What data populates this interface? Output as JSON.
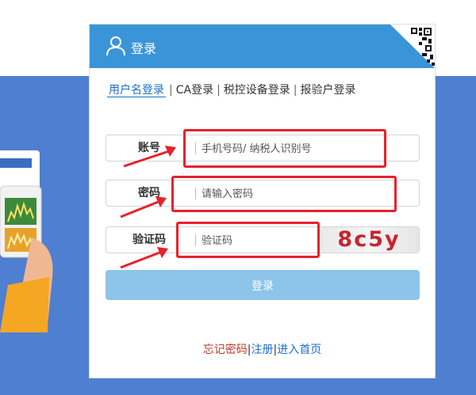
{
  "header": {
    "title": "登录"
  },
  "tabs": [
    {
      "label": "用户名登录",
      "active": true
    },
    {
      "label": "CA登录",
      "active": false
    },
    {
      "label": "税控设备登录",
      "active": false
    },
    {
      "label": "报验户登录",
      "active": false
    }
  ],
  "fields": {
    "account": {
      "label": "账号",
      "placeholder": "手机号码/ 纳税人识别号",
      "value": ""
    },
    "password": {
      "label": "密码",
      "placeholder": "请输入密码",
      "value": ""
    },
    "captcha": {
      "label": "验证码",
      "placeholder": "验证码",
      "value": "",
      "code": "8c5y"
    }
  },
  "login_button": "登录",
  "footer": {
    "forgot": "忘记密码",
    "separator": "|",
    "register": "注册",
    "home": "进入首页"
  },
  "colors": {
    "header": "#3a95d8",
    "background_band": "#4f7fd0",
    "highlight": "#e8212b",
    "button": "#8cc4ea"
  }
}
